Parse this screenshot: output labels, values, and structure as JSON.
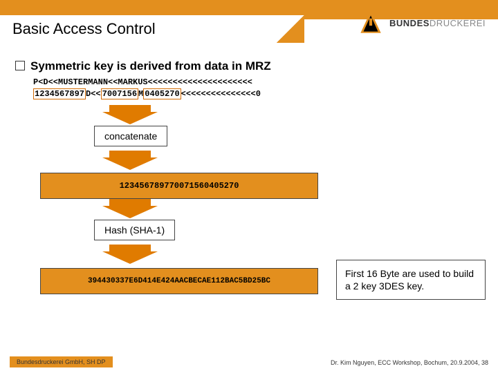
{
  "title": "Basic Access Control",
  "logo": {
    "line1": "BUNDES",
    "line2": "DRUCKEREI"
  },
  "bullet": "Symmetric key is derived from data in MRZ",
  "mrz": {
    "line1": "P<D<<MUSTERMANN<<MARKUS<<<<<<<<<<<<<<<<<<<<<",
    "line2_a": "1234567897",
    "line2_b": "D<<",
    "line2_c": "7007156",
    "line2_d": "M",
    "line2_e": "0405270",
    "line2_f": "<<<<<<<<<<<<<<<0"
  },
  "step1_label": "concatenate",
  "concat_value": "123456789770071560405270",
  "step2_label": "Hash (SHA-1)",
  "hash_value": "394430337E6D414E424AACBECAE112BAC5BD25BC",
  "note": "First 16 Byte are used to build a 2 key 3DES key.",
  "footer_left": "Bundesdruckerei GmbH, SH DP",
  "footer_right": "Dr. Kim Nguyen, ECC Workshop, Bochum, 20.9.2004,  38"
}
